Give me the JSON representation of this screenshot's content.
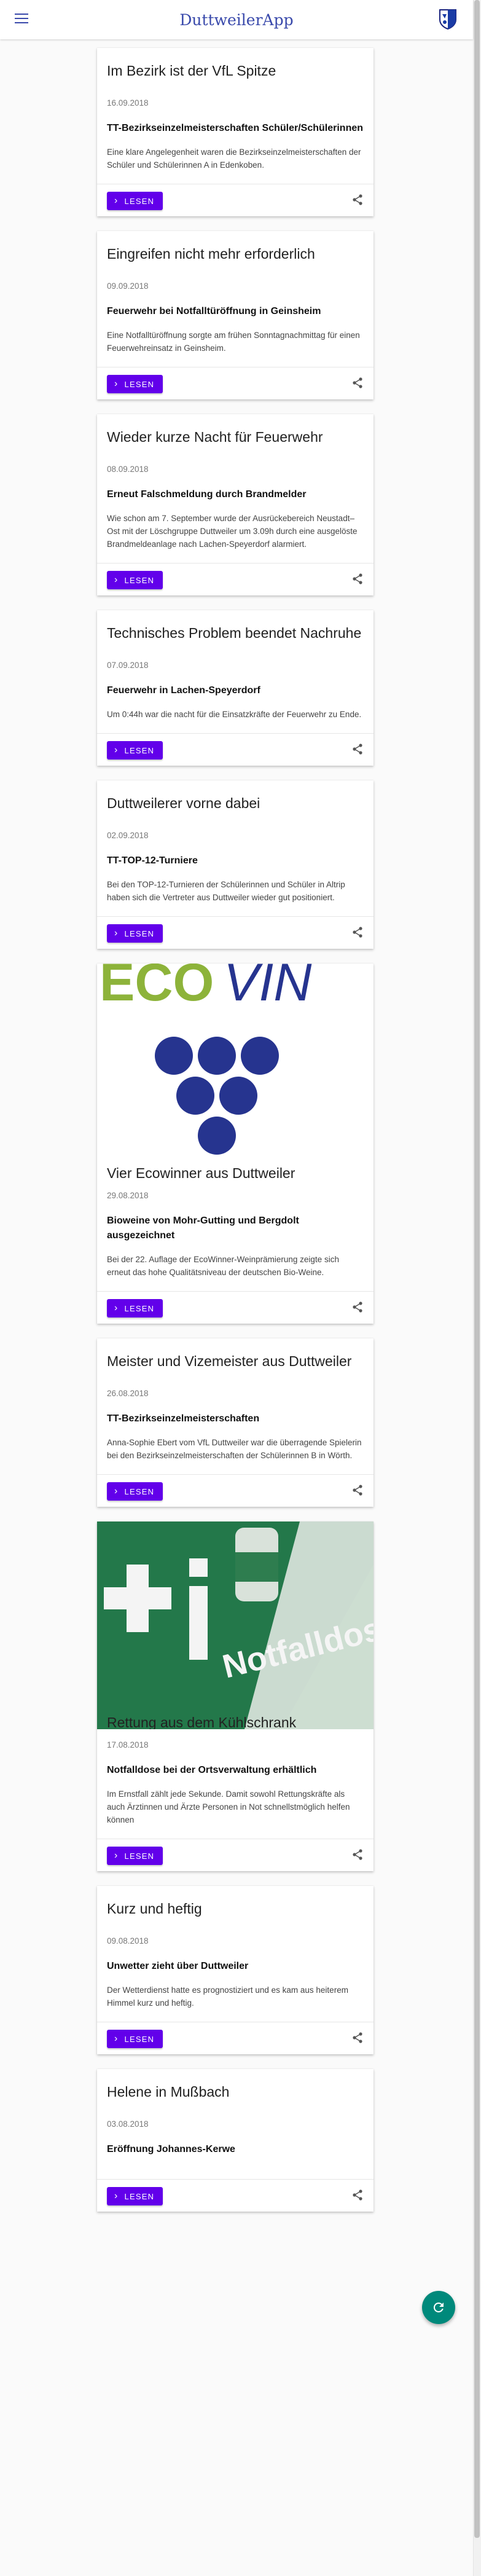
{
  "app": {
    "title": "DuttweilerApp"
  },
  "ui": {
    "read_label": "LESEN"
  },
  "icons": {
    "menu": "menu-icon",
    "crest": "crest-icon",
    "share": "share-icon",
    "refresh": "refresh-icon",
    "chevron": "chevron-right-icon"
  },
  "colors": {
    "brand": "#3949ab",
    "button": "#6200ea",
    "fab": "#00897b"
  },
  "articles": [
    {
      "title": "Im Bezirk ist der VfL Spitze",
      "date": "16.09.2018",
      "subtitle": "TT-Bezirkseinzelmeisterschaften Schüler/Schülerinnen",
      "text": "Eine klare Angelegenheit waren die Bezirkseinzelmeisterschaften der Schüler und Schülerinnen A in Edenkoben."
    },
    {
      "title": "Eingreifen nicht mehr erforderlich",
      "date": "09.09.2018",
      "subtitle": "Feuerwehr bei Notfalltüröffnung in Geinsheim",
      "text": "Eine Notfalltüröffnung sorgte am frühen Sonntagnachmittag für einen Feuerwehreinsatz in Geinsheim."
    },
    {
      "title": "Wieder kurze Nacht für Feuerwehr",
      "date": "08.09.2018",
      "subtitle": "Erneut Falschmeldung durch Brandmelder",
      "text": "Wie schon am 7. September wurde der Ausrückebereich Neustadt–Ost mit der Löschgruppe Duttweiler um 3.09h durch eine ausgelöste Brandmeldeanlage nach Lachen-Speyerdorf alarmiert."
    },
    {
      "title": "Technisches Problem beendet Nachruhe",
      "date": "07.09.2018",
      "subtitle": "Feuerwehr in Lachen-Speyerdorf",
      "text": "Um 0:44h war die nacht für die Einsatzkräfte der Feuerwehr zu Ende."
    },
    {
      "title": "Duttweilerer vorne dabei",
      "date": "02.09.2018",
      "subtitle": "TT-TOP-12-Turniere",
      "text": "Bei den TOP-12-Turnieren der Schülerinnen und Schüler in Altrip haben sich die Vertreter aus Duttweiler wieder gut positioniert."
    },
    {
      "title": "Vier Ecowinner aus Duttweiler",
      "date": "29.08.2018",
      "subtitle": "Bioweine von Mohr-Gutting und Bergdolt ausgezeichnet",
      "text": "Bei der 22. Auflage der EcoWinner-Weinprämierung zeigte sich erneut das hohe Qualitätsniveau der deutschen Bio-Weine.",
      "image_logo": "ECOVIN"
    },
    {
      "title": "Meister und Vizemeister aus Duttweiler",
      "date": "26.08.2018",
      "subtitle": "TT-Bezirkseinzelmeisterschaften",
      "text": "Anna-Sophie Ebert vom VfL Duttweiler war die überragende Spielerin bei den Bezirkseinzelmeisterschaften der Schülerinnen B in Wörth."
    },
    {
      "title": "Rettung aus dem Kühlschrank",
      "date": "17.08.2018",
      "subtitle": "Notfalldose bei der Ortsverwaltung erhältlich",
      "text": "Im Ernstfall zählt jede Sekunde. Damit sowohl Rettungskräfte als auch Ärztinnen und Ärzte Personen in Not schnellstmöglich helfen können",
      "image_label": "Notfalldose"
    },
    {
      "title": "Kurz und heftig",
      "date": "09.08.2018",
      "subtitle": "Unwetter zieht über Duttweiler",
      "text": "Der Wetterdienst hatte es prognostiziert und es kam aus heiterem Himmel kurz und heftig."
    },
    {
      "title": "Helene in Mußbach",
      "date": "03.08.2018",
      "subtitle": "Eröffnung Johannes-Kerwe",
      "text": ""
    }
  ]
}
